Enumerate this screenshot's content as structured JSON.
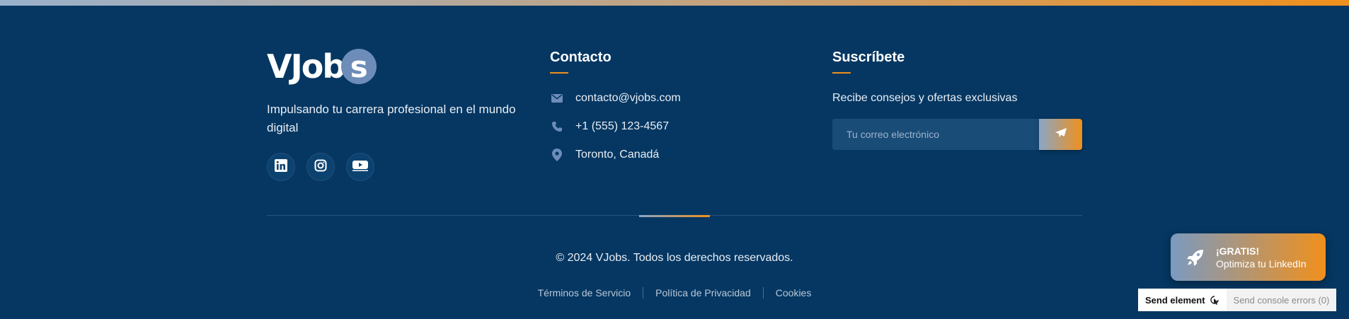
{
  "brand": {
    "logo_text": "VJob",
    "logo_badge": "s",
    "tagline": "Impulsando tu carrera profesional en el mundo digital"
  },
  "social": [
    {
      "icon": "linkedin-icon"
    },
    {
      "icon": "instagram-icon"
    },
    {
      "icon": "youtube-icon"
    }
  ],
  "contact": {
    "title": "Contacto",
    "email": "contacto@vjobs.com",
    "phone": "+1 (555) 123-4567",
    "location": "Toronto, Canadá"
  },
  "subscribe": {
    "title": "Suscríbete",
    "text": "Recibe consejos y ofertas exclusivas",
    "placeholder": "Tu correo electrónico"
  },
  "footer": {
    "copyright": "© 2024 VJobs. Todos los derechos reservados.",
    "links": [
      "Términos de Servicio",
      "Política de Privacidad",
      "Cookies"
    ]
  },
  "promo": {
    "line1": "¡GRATIS!",
    "line2": "Optimiza tu LinkedIn"
  },
  "devtools": {
    "send_element": "Send element",
    "send_errors": "Send console errors (0)"
  },
  "colors": {
    "background": "#053762",
    "accent": "#f0901c",
    "muted_blue": "#6d8db8"
  }
}
